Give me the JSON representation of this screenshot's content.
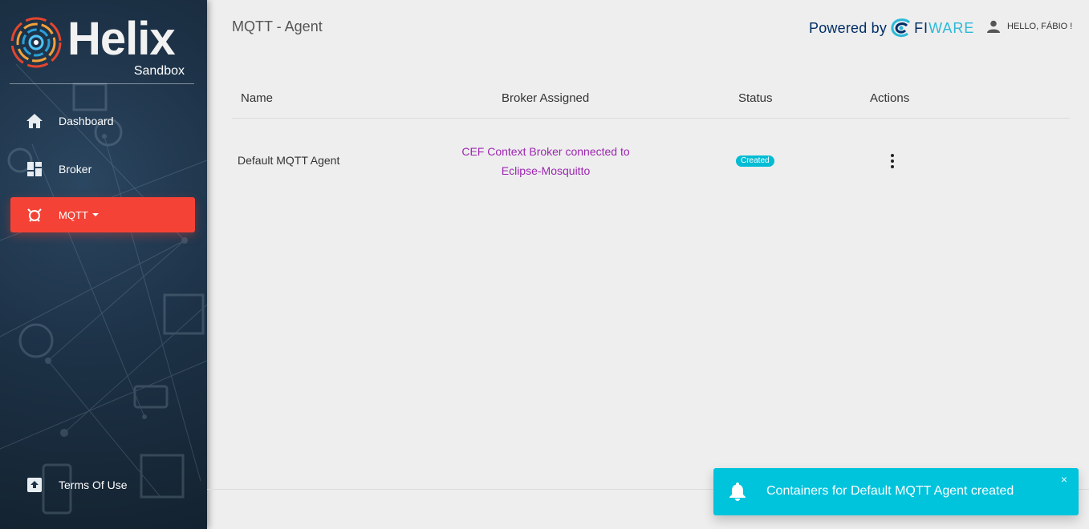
{
  "brand": {
    "name": "Helix",
    "subtitle": "Sandbox"
  },
  "sidebar": {
    "items": [
      {
        "label": "Dashboard",
        "icon": "home-icon"
      },
      {
        "label": "Broker",
        "icon": "dashboard-icon"
      },
      {
        "label": "MQTT",
        "icon": "mqtt-icon",
        "active": true,
        "dropdown": true
      },
      {
        "label": "Terms Of Use",
        "icon": "upload-box-icon"
      }
    ]
  },
  "header": {
    "title": "MQTT - Agent",
    "powered_by": "Powered by",
    "fiware_fi": "FI",
    "fiware_ware": "WARE",
    "user": "HELLO, FÁBIO !"
  },
  "table": {
    "columns": [
      "Name",
      "Broker Assigned",
      "Status",
      "Actions"
    ],
    "rows": [
      {
        "name": "Default MQTT Agent",
        "broker_line1": "CEF Context Broker connected to",
        "broker_line2": "Eclipse-Mosquitto",
        "status": "Created"
      }
    ]
  },
  "footer": {
    "peek": "!"
  },
  "notification": {
    "message": "Containers for Default MQTT Agent created",
    "close": "×"
  },
  "colors": {
    "active_nav": "#f44336",
    "link_purple": "#9c27b0",
    "status_badge": "#00bcd4",
    "notification": "#00c3dc"
  }
}
